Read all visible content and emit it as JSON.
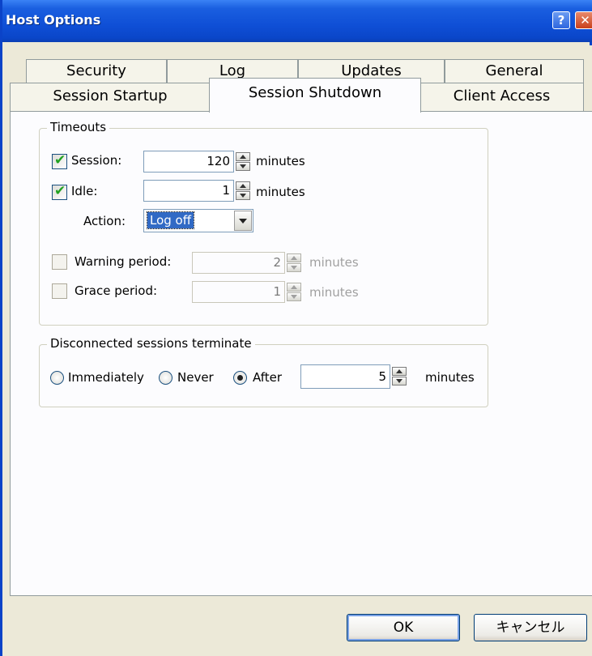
{
  "window": {
    "title": "Host Options",
    "help_glyph": "?",
    "close_glyph": "✕"
  },
  "tabs": {
    "row_top": [
      "Security",
      "Log",
      "Updates",
      "General"
    ],
    "row_bottom": [
      "Session Startup",
      "Session Shutdown",
      "Client Access"
    ],
    "active": "Session Shutdown"
  },
  "timeouts": {
    "group_title": "Timeouts",
    "session": {
      "label": "Session:",
      "checked": true,
      "value": "120",
      "unit": "minutes"
    },
    "idle": {
      "label": "Idle:",
      "checked": true,
      "value": "1",
      "unit": "minutes"
    },
    "action": {
      "label": "Action:",
      "value": "Log off"
    },
    "warning": {
      "label": "Warning period:",
      "checked": false,
      "value": "2",
      "unit": "minutes"
    },
    "grace": {
      "label": "Grace period:",
      "checked": false,
      "value": "1",
      "unit": "minutes"
    }
  },
  "disconnected": {
    "group_title": "Disconnected sessions terminate",
    "options": [
      "Immediately",
      "Never",
      "After"
    ],
    "selected": "After",
    "value": "5",
    "unit": "minutes"
  },
  "buttons": {
    "ok": "OK",
    "cancel": "キャンセル"
  }
}
